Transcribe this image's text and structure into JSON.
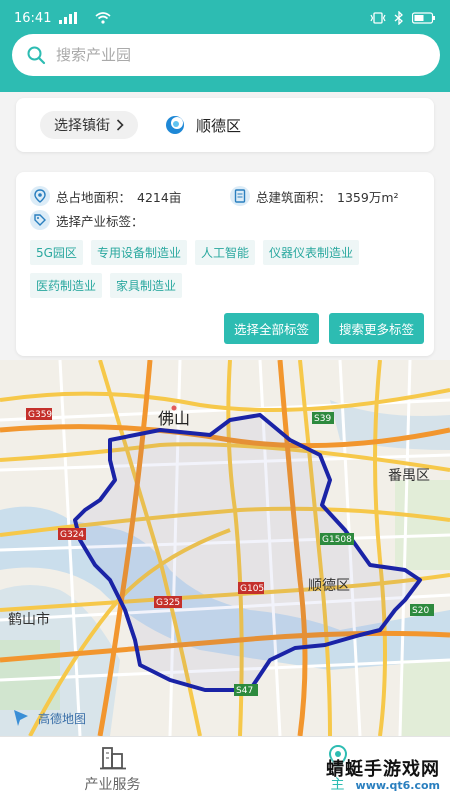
{
  "status_bar": {
    "time": "16:41",
    "signal": "4G",
    "battery": "battery-icon"
  },
  "search": {
    "placeholder": "搜索产业园"
  },
  "town": {
    "select_label": "选择镇街",
    "district": "顺德区"
  },
  "stats": {
    "land_area_label": "总占地面积：",
    "land_area_value": "4214亩",
    "building_area_label": "总建筑面积：",
    "building_area_value": "1359万m²"
  },
  "tags": {
    "label": "选择产业标签：",
    "items": [
      "5G园区",
      "专用设备制造业",
      "人工智能",
      "仪器仪表制造业",
      "医药制造业",
      "家具制造业"
    ],
    "select_all": "选择全部标签",
    "search_more": "搜索更多标签"
  },
  "map": {
    "labels": {
      "foshan": "佛山",
      "panyu": "番禺区",
      "shunde": "顺德区",
      "heshan": "鹤山市",
      "attribution": "高德地图"
    },
    "roads": {
      "g359": "G359",
      "s39": "S39",
      "g324": "G324",
      "g1508": "G1508",
      "g325": "G325",
      "g105": "G105",
      "s20": "S20",
      "s47": "S47"
    }
  },
  "nav": {
    "items": [
      {
        "label": "产业服务",
        "icon": "building-icon"
      },
      {
        "label": "主",
        "icon": "location-icon"
      }
    ]
  },
  "watermark": {
    "line1": "蜻蜓手游戏网",
    "line2": "www.qt6.com"
  },
  "colors": {
    "accent": "#2dbcb2",
    "boundary": "#1a23a6"
  }
}
